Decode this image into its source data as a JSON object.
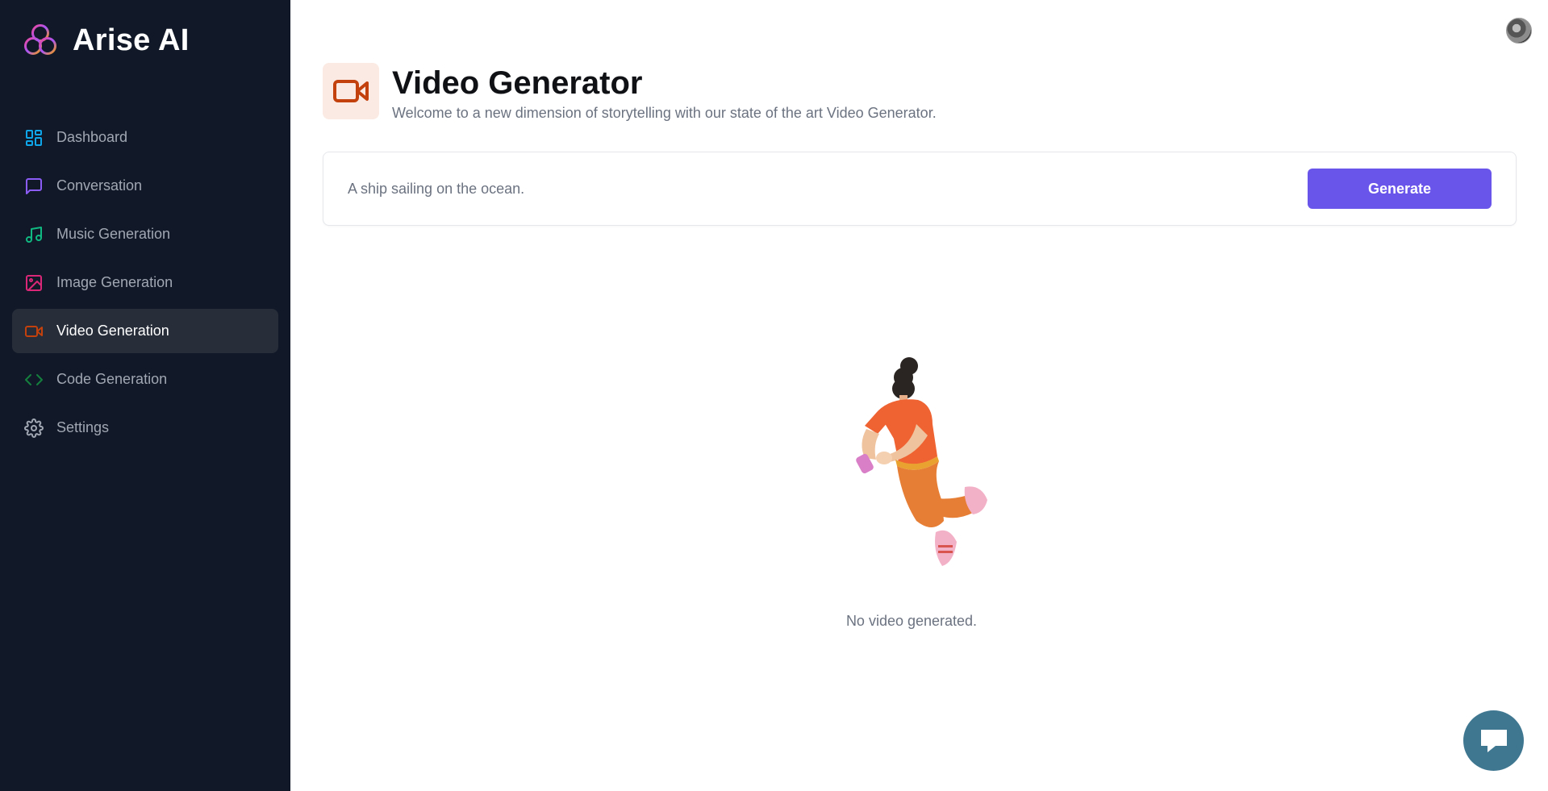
{
  "app": {
    "name": "Arise AI"
  },
  "sidebar": {
    "items": [
      {
        "label": "Dashboard",
        "icon": "dashboard-icon",
        "color": "#0ea5e9",
        "active": false
      },
      {
        "label": "Conversation",
        "icon": "message-square-icon",
        "color": "#8b5cf6",
        "active": false
      },
      {
        "label": "Music Generation",
        "icon": "music-icon",
        "color": "#10b981",
        "active": false
      },
      {
        "label": "Image Generation",
        "icon": "image-icon",
        "color": "#db2777",
        "active": false
      },
      {
        "label": "Video Generation",
        "icon": "video-icon",
        "color": "#c2410c",
        "active": true
      },
      {
        "label": "Code Generation",
        "icon": "code-icon",
        "color": "#15803d",
        "active": false
      },
      {
        "label": "Settings",
        "icon": "gear-icon",
        "color": "#a1a7b3",
        "active": false
      }
    ]
  },
  "header": {
    "title": "Video Generator",
    "subtitle": "Welcome to a new dimension of storytelling with our state of the art Video Generator.",
    "icon": "video-icon",
    "icon_color": "#c2410c",
    "icon_bg": "#fbeae3"
  },
  "prompt": {
    "value": "A ship sailing on the ocean.",
    "button_label": "Generate",
    "button_color": "#6a55ea"
  },
  "empty_state": {
    "text": "No video generated."
  },
  "colors": {
    "sidebar_bg": "#111827",
    "active_item_bg": "#272d39",
    "chat_bubble": "#3f7791"
  }
}
